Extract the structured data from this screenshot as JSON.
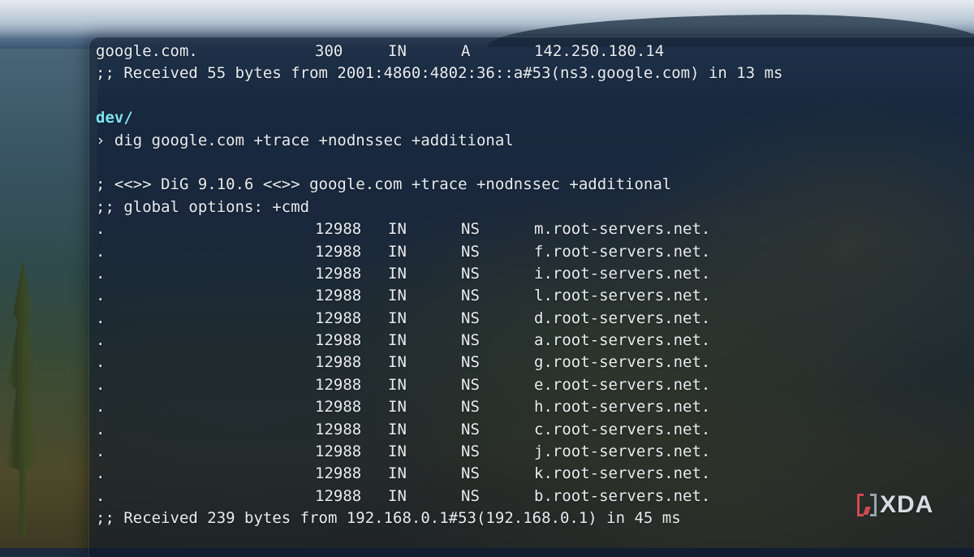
{
  "terminal": {
    "lines": [
      {
        "type": "record",
        "cols": [
          "google.com.",
          "300",
          "IN",
          "A",
          "142.250.180.14"
        ]
      },
      {
        "type": "text",
        "text": ";; Received 55 bytes from 2001:4860:4802:36::a#53(ns3.google.com) in 13 ms"
      },
      {
        "type": "blank",
        "text": ""
      },
      {
        "type": "prompt",
        "text": "dev/"
      },
      {
        "type": "text",
        "text": "› dig google.com +trace +nodnssec +additional"
      },
      {
        "type": "blank",
        "text": ""
      },
      {
        "type": "text",
        "text": "; <<>> DiG 9.10.6 <<>> google.com +trace +nodnssec +additional"
      },
      {
        "type": "text",
        "text": ";; global options: +cmd"
      },
      {
        "type": "record",
        "cols": [
          ".",
          "12988",
          "IN",
          "NS",
          "m.root-servers.net."
        ]
      },
      {
        "type": "record",
        "cols": [
          ".",
          "12988",
          "IN",
          "NS",
          "f.root-servers.net."
        ]
      },
      {
        "type": "record",
        "cols": [
          ".",
          "12988",
          "IN",
          "NS",
          "i.root-servers.net."
        ]
      },
      {
        "type": "record",
        "cols": [
          ".",
          "12988",
          "IN",
          "NS",
          "l.root-servers.net."
        ]
      },
      {
        "type": "record",
        "cols": [
          ".",
          "12988",
          "IN",
          "NS",
          "d.root-servers.net."
        ]
      },
      {
        "type": "record",
        "cols": [
          ".",
          "12988",
          "IN",
          "NS",
          "a.root-servers.net."
        ]
      },
      {
        "type": "record",
        "cols": [
          ".",
          "12988",
          "IN",
          "NS",
          "g.root-servers.net."
        ]
      },
      {
        "type": "record",
        "cols": [
          ".",
          "12988",
          "IN",
          "NS",
          "e.root-servers.net."
        ]
      },
      {
        "type": "record",
        "cols": [
          ".",
          "12988",
          "IN",
          "NS",
          "h.root-servers.net."
        ]
      },
      {
        "type": "record",
        "cols": [
          ".",
          "12988",
          "IN",
          "NS",
          "c.root-servers.net."
        ]
      },
      {
        "type": "record",
        "cols": [
          ".",
          "12988",
          "IN",
          "NS",
          "j.root-servers.net."
        ]
      },
      {
        "type": "record",
        "cols": [
          ".",
          "12988",
          "IN",
          "NS",
          "k.root-servers.net."
        ]
      },
      {
        "type": "record",
        "cols": [
          ".",
          "12988",
          "IN",
          "NS",
          "b.root-servers.net."
        ]
      },
      {
        "type": "text",
        "text": ";; Received 239 bytes from 192.168.0.1#53(192.168.0.1) in 45 ms"
      }
    ]
  },
  "watermark": {
    "text": "XDA",
    "icon": "xda-logo-icon",
    "accent_color": "#d04b52"
  },
  "colors": {
    "terminal_text": "#e8ecf0",
    "prompt_text": "#7fe3f0"
  }
}
